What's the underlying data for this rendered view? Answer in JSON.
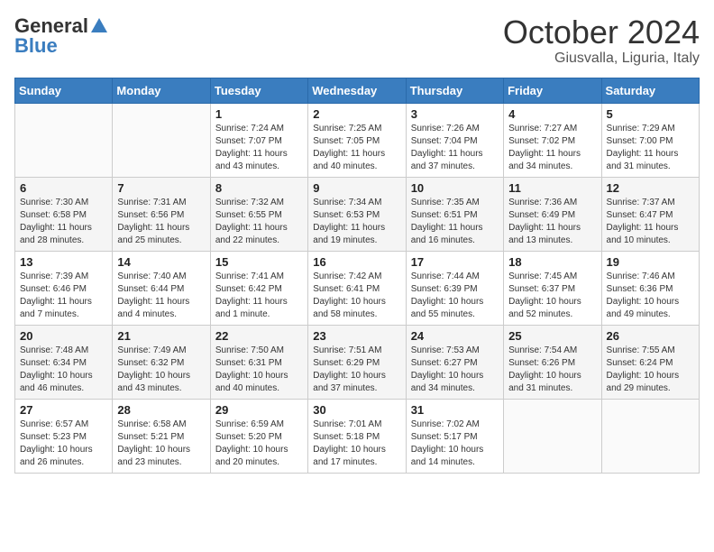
{
  "header": {
    "logo_general": "General",
    "logo_blue": "Blue",
    "month": "October 2024",
    "location": "Giusvalla, Liguria, Italy"
  },
  "days_of_week": [
    "Sunday",
    "Monday",
    "Tuesday",
    "Wednesday",
    "Thursday",
    "Friday",
    "Saturday"
  ],
  "weeks": [
    [
      {
        "day": "",
        "sunrise": "",
        "sunset": "",
        "daylight": ""
      },
      {
        "day": "",
        "sunrise": "",
        "sunset": "",
        "daylight": ""
      },
      {
        "day": "1",
        "sunrise": "Sunrise: 7:24 AM",
        "sunset": "Sunset: 7:07 PM",
        "daylight": "Daylight: 11 hours and 43 minutes."
      },
      {
        "day": "2",
        "sunrise": "Sunrise: 7:25 AM",
        "sunset": "Sunset: 7:05 PM",
        "daylight": "Daylight: 11 hours and 40 minutes."
      },
      {
        "day": "3",
        "sunrise": "Sunrise: 7:26 AM",
        "sunset": "Sunset: 7:04 PM",
        "daylight": "Daylight: 11 hours and 37 minutes."
      },
      {
        "day": "4",
        "sunrise": "Sunrise: 7:27 AM",
        "sunset": "Sunset: 7:02 PM",
        "daylight": "Daylight: 11 hours and 34 minutes."
      },
      {
        "day": "5",
        "sunrise": "Sunrise: 7:29 AM",
        "sunset": "Sunset: 7:00 PM",
        "daylight": "Daylight: 11 hours and 31 minutes."
      }
    ],
    [
      {
        "day": "6",
        "sunrise": "Sunrise: 7:30 AM",
        "sunset": "Sunset: 6:58 PM",
        "daylight": "Daylight: 11 hours and 28 minutes."
      },
      {
        "day": "7",
        "sunrise": "Sunrise: 7:31 AM",
        "sunset": "Sunset: 6:56 PM",
        "daylight": "Daylight: 11 hours and 25 minutes."
      },
      {
        "day": "8",
        "sunrise": "Sunrise: 7:32 AM",
        "sunset": "Sunset: 6:55 PM",
        "daylight": "Daylight: 11 hours and 22 minutes."
      },
      {
        "day": "9",
        "sunrise": "Sunrise: 7:34 AM",
        "sunset": "Sunset: 6:53 PM",
        "daylight": "Daylight: 11 hours and 19 minutes."
      },
      {
        "day": "10",
        "sunrise": "Sunrise: 7:35 AM",
        "sunset": "Sunset: 6:51 PM",
        "daylight": "Daylight: 11 hours and 16 minutes."
      },
      {
        "day": "11",
        "sunrise": "Sunrise: 7:36 AM",
        "sunset": "Sunset: 6:49 PM",
        "daylight": "Daylight: 11 hours and 13 minutes."
      },
      {
        "day": "12",
        "sunrise": "Sunrise: 7:37 AM",
        "sunset": "Sunset: 6:47 PM",
        "daylight": "Daylight: 11 hours and 10 minutes."
      }
    ],
    [
      {
        "day": "13",
        "sunrise": "Sunrise: 7:39 AM",
        "sunset": "Sunset: 6:46 PM",
        "daylight": "Daylight: 11 hours and 7 minutes."
      },
      {
        "day": "14",
        "sunrise": "Sunrise: 7:40 AM",
        "sunset": "Sunset: 6:44 PM",
        "daylight": "Daylight: 11 hours and 4 minutes."
      },
      {
        "day": "15",
        "sunrise": "Sunrise: 7:41 AM",
        "sunset": "Sunset: 6:42 PM",
        "daylight": "Daylight: 11 hours and 1 minute."
      },
      {
        "day": "16",
        "sunrise": "Sunrise: 7:42 AM",
        "sunset": "Sunset: 6:41 PM",
        "daylight": "Daylight: 10 hours and 58 minutes."
      },
      {
        "day": "17",
        "sunrise": "Sunrise: 7:44 AM",
        "sunset": "Sunset: 6:39 PM",
        "daylight": "Daylight: 10 hours and 55 minutes."
      },
      {
        "day": "18",
        "sunrise": "Sunrise: 7:45 AM",
        "sunset": "Sunset: 6:37 PM",
        "daylight": "Daylight: 10 hours and 52 minutes."
      },
      {
        "day": "19",
        "sunrise": "Sunrise: 7:46 AM",
        "sunset": "Sunset: 6:36 PM",
        "daylight": "Daylight: 10 hours and 49 minutes."
      }
    ],
    [
      {
        "day": "20",
        "sunrise": "Sunrise: 7:48 AM",
        "sunset": "Sunset: 6:34 PM",
        "daylight": "Daylight: 10 hours and 46 minutes."
      },
      {
        "day": "21",
        "sunrise": "Sunrise: 7:49 AM",
        "sunset": "Sunset: 6:32 PM",
        "daylight": "Daylight: 10 hours and 43 minutes."
      },
      {
        "day": "22",
        "sunrise": "Sunrise: 7:50 AM",
        "sunset": "Sunset: 6:31 PM",
        "daylight": "Daylight: 10 hours and 40 minutes."
      },
      {
        "day": "23",
        "sunrise": "Sunrise: 7:51 AM",
        "sunset": "Sunset: 6:29 PM",
        "daylight": "Daylight: 10 hours and 37 minutes."
      },
      {
        "day": "24",
        "sunrise": "Sunrise: 7:53 AM",
        "sunset": "Sunset: 6:27 PM",
        "daylight": "Daylight: 10 hours and 34 minutes."
      },
      {
        "day": "25",
        "sunrise": "Sunrise: 7:54 AM",
        "sunset": "Sunset: 6:26 PM",
        "daylight": "Daylight: 10 hours and 31 minutes."
      },
      {
        "day": "26",
        "sunrise": "Sunrise: 7:55 AM",
        "sunset": "Sunset: 6:24 PM",
        "daylight": "Daylight: 10 hours and 29 minutes."
      }
    ],
    [
      {
        "day": "27",
        "sunrise": "Sunrise: 6:57 AM",
        "sunset": "Sunset: 5:23 PM",
        "daylight": "Daylight: 10 hours and 26 minutes."
      },
      {
        "day": "28",
        "sunrise": "Sunrise: 6:58 AM",
        "sunset": "Sunset: 5:21 PM",
        "daylight": "Daylight: 10 hours and 23 minutes."
      },
      {
        "day": "29",
        "sunrise": "Sunrise: 6:59 AM",
        "sunset": "Sunset: 5:20 PM",
        "daylight": "Daylight: 10 hours and 20 minutes."
      },
      {
        "day": "30",
        "sunrise": "Sunrise: 7:01 AM",
        "sunset": "Sunset: 5:18 PM",
        "daylight": "Daylight: 10 hours and 17 minutes."
      },
      {
        "day": "31",
        "sunrise": "Sunrise: 7:02 AM",
        "sunset": "Sunset: 5:17 PM",
        "daylight": "Daylight: 10 hours and 14 minutes."
      },
      {
        "day": "",
        "sunrise": "",
        "sunset": "",
        "daylight": ""
      },
      {
        "day": "",
        "sunrise": "",
        "sunset": "",
        "daylight": ""
      }
    ]
  ]
}
